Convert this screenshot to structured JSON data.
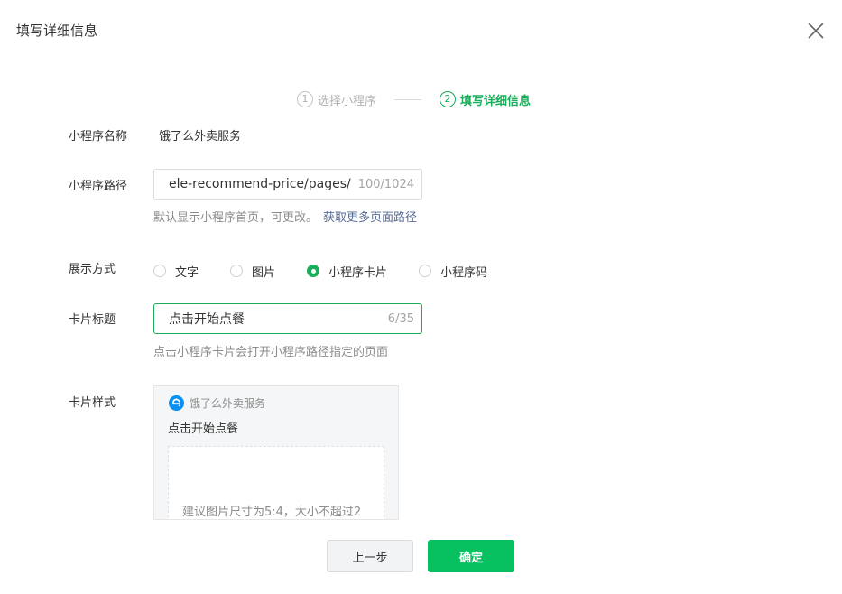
{
  "dialog": {
    "title": "填写详细信息",
    "close_icon": "close-icon"
  },
  "steps": [
    {
      "num": "1",
      "label": "选择小程序",
      "state": "inactive"
    },
    {
      "num": "2",
      "label": "填写详细信息",
      "state": "active"
    }
  ],
  "form": {
    "name": {
      "label": "小程序名称",
      "value": "饿了么外卖服务"
    },
    "path": {
      "label": "小程序路径",
      "value": "ele-recommend-price/pages/",
      "count": "100/1024",
      "hint": "默认显示小程序首页，可更改。",
      "hint_link": "获取更多页面路径"
    },
    "display": {
      "label": "展示方式",
      "options": [
        {
          "label": "文字",
          "checked": false
        },
        {
          "label": "图片",
          "checked": false
        },
        {
          "label": "小程序卡片",
          "checked": true
        },
        {
          "label": "小程序码",
          "checked": false
        }
      ]
    },
    "card_title": {
      "label": "卡片标题",
      "value": "点击开始点餐",
      "count": "6/35",
      "hint": "点击小程序卡片会打开小程序路径指定的页面"
    },
    "card_style": {
      "label": "卡片样式",
      "preview": {
        "app_name": "饿了么外卖服务",
        "title": "点击开始点餐",
        "image_hint": "建议图片尺寸为5:4，大小不超过2",
        "logo_icon": "eleme-logo-icon"
      }
    }
  },
  "footer": {
    "prev_label": "上一步",
    "confirm_label": "确定"
  },
  "colors": {
    "accent": "#07c160",
    "step_active": "#1aad5a",
    "link": "#576b95",
    "logo": "#0a90f2"
  }
}
